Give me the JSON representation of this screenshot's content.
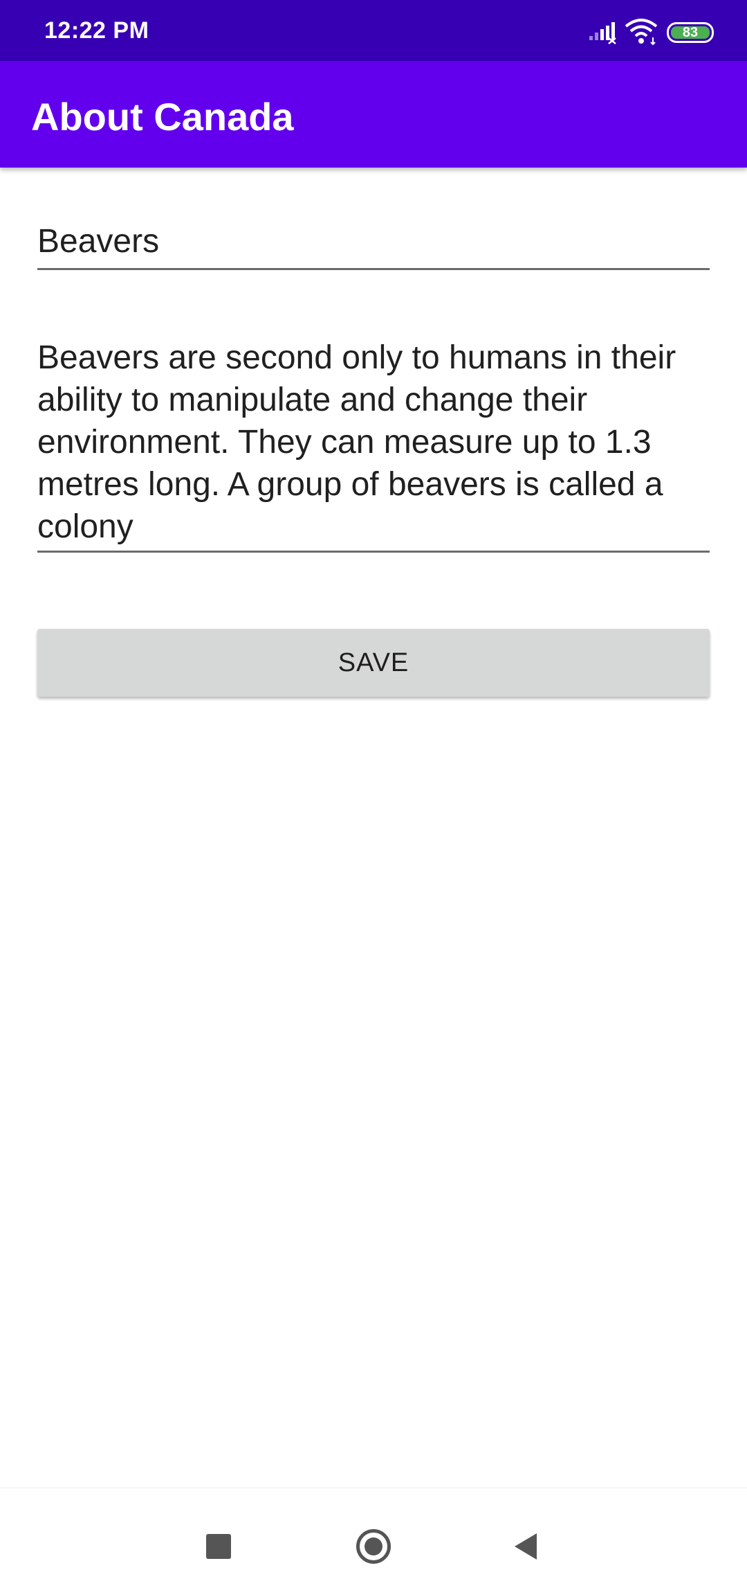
{
  "status_bar": {
    "time": "12:22 PM",
    "battery_level": "83",
    "icons": [
      "signal-icon",
      "wifi-icon",
      "battery-icon"
    ],
    "background_color": "#3700b3"
  },
  "app_bar": {
    "title": "About Canada",
    "background_color": "#6200ee"
  },
  "form": {
    "title_value": "Beavers",
    "body_value": "Beavers are second only to humans in their ability to manipulate and change their environment. They can measure up to 1.3 metres long. A group of beavers is called a colony",
    "save_label": "SAVE"
  },
  "nav_bar": {
    "icons": [
      "recents-icon",
      "home-icon",
      "back-icon"
    ]
  }
}
